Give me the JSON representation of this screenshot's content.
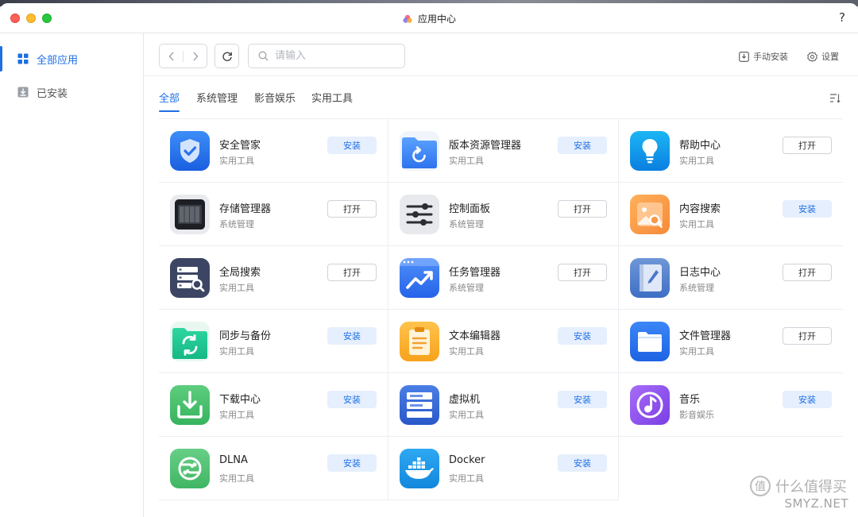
{
  "window": {
    "title": "应用中心",
    "help": "?"
  },
  "sidebar": {
    "items": [
      {
        "label": "全部应用",
        "icon": "grid-icon",
        "active": true
      },
      {
        "label": "已安装",
        "icon": "download-box-icon",
        "active": false
      }
    ]
  },
  "toolbar": {
    "search_placeholder": "请输入",
    "manual_install": "手动安装",
    "settings": "设置"
  },
  "tabs": [
    "全部",
    "系统管理",
    "影音娱乐",
    "实用工具"
  ],
  "apps": [
    {
      "name": "安全管家",
      "category": "实用工具",
      "action": "安装",
      "icon": "shield-icon"
    },
    {
      "name": "版本资源管理器",
      "category": "实用工具",
      "action": "安装",
      "icon": "folder-restore-icon"
    },
    {
      "name": "帮助中心",
      "category": "实用工具",
      "action": "打开",
      "icon": "lightbulb-icon"
    },
    {
      "name": "存储管理器",
      "category": "系统管理",
      "action": "打开",
      "icon": "storage-drive-icon"
    },
    {
      "name": "控制面板",
      "category": "系统管理",
      "action": "打开",
      "icon": "sliders-icon"
    },
    {
      "name": "内容搜索",
      "category": "实用工具",
      "action": "安装",
      "icon": "image-search-icon"
    },
    {
      "name": "全局搜索",
      "category": "实用工具",
      "action": "打开",
      "icon": "global-search-icon"
    },
    {
      "name": "任务管理器",
      "category": "系统管理",
      "action": "打开",
      "icon": "task-chart-icon"
    },
    {
      "name": "日志中心",
      "category": "系统管理",
      "action": "打开",
      "icon": "log-notebook-icon"
    },
    {
      "name": "同步与备份",
      "category": "实用工具",
      "action": "安装",
      "icon": "sync-folder-icon"
    },
    {
      "name": "文本编辑器",
      "category": "实用工具",
      "action": "安装",
      "icon": "clipboard-text-icon"
    },
    {
      "name": "文件管理器",
      "category": "实用工具",
      "action": "打开",
      "icon": "folder-icon"
    },
    {
      "name": "下载中心",
      "category": "实用工具",
      "action": "安装",
      "icon": "download-tray-icon"
    },
    {
      "name": "虚拟机",
      "category": "实用工具",
      "action": "安装",
      "icon": "server-vm-icon"
    },
    {
      "name": "音乐",
      "category": "影音娱乐",
      "action": "安装",
      "icon": "music-note-icon"
    },
    {
      "name": "DLNA",
      "category": "实用工具",
      "action": "安装",
      "icon": "dlna-share-icon"
    },
    {
      "name": "Docker",
      "category": "实用工具",
      "action": "安装",
      "icon": "docker-whale-icon"
    }
  ],
  "watermark": {
    "text": "什么值得买",
    "sub": "SMYZ.NET",
    "logo_char": "值"
  }
}
